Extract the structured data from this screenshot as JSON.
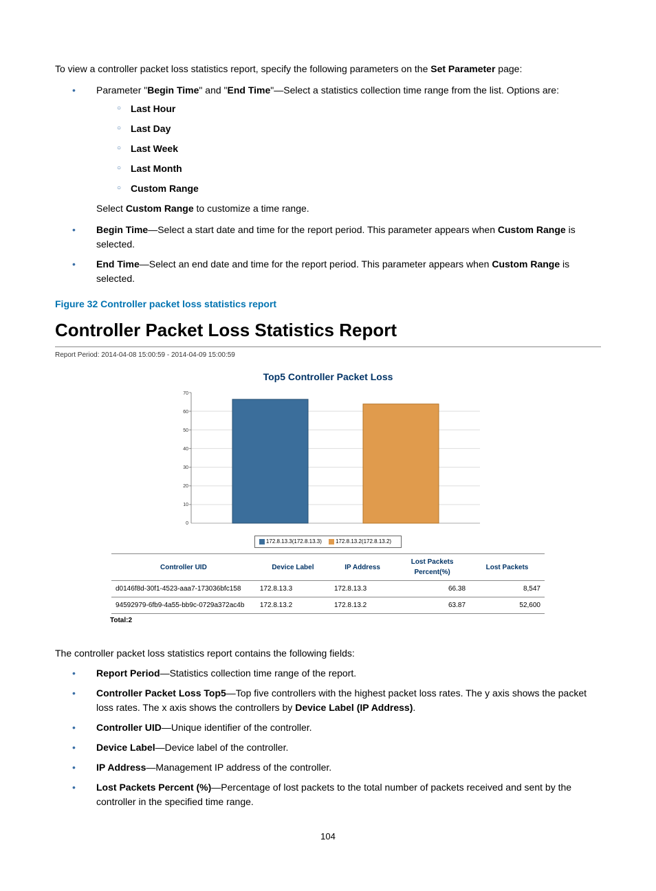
{
  "intro": {
    "prefix": "To view a controller packet loss statistics report, specify the following parameters on the ",
    "bold": "Set Parameter",
    "suffix": " page:"
  },
  "param_list": {
    "item1": {
      "prefix": "Parameter \"",
      "bold1": "Begin Time",
      "mid1": "\" and \"",
      "bold2": "End Time",
      "suffix": "\"—Select a statistics collection time range from the list. Options are:"
    },
    "options": [
      "Last Hour",
      "Last Day",
      "Last Week",
      "Last Month",
      "Custom Range"
    ],
    "sub_note": {
      "prefix": "Select ",
      "bold": "Custom Range",
      "suffix": " to customize a time range."
    },
    "item2": {
      "bold": "Begin Time",
      "text": "—Select a start date and time for the report period. This parameter appears when ",
      "bold2": "Custom Range",
      "suffix": " is selected."
    },
    "item3": {
      "bold": "End Time",
      "text": "—Select an end date and time for the report period. This parameter appears when ",
      "bold2": "Custom Range",
      "suffix": " is selected."
    }
  },
  "figure_caption": "Figure 32 Controller packet loss statistics report",
  "report": {
    "title": "Controller Packet Loss Statistics Report",
    "period": "Report Period: 2014-04-08 15:00:59  -  2014-04-09 15:00:59",
    "chart_title": "Top5 Controller Packet Loss",
    "legend": [
      {
        "color": "#3b6e9b",
        "label": "172.8.13.3(172.8.13.3)"
      },
      {
        "color": "#e09b4d",
        "label": "172.8.13.2(172.8.13.2)"
      }
    ],
    "table": {
      "headers": [
        "Controller UID",
        "Device Label",
        "IP Address",
        "Lost Packets\nPercent(%)",
        "Lost  Packets"
      ],
      "rows": [
        {
          "uid": "d0146f8d-30f1-4523-aaa7-173036bfc158",
          "label": "172.8.13.3",
          "ip": "172.8.13.3",
          "pct": "66.38",
          "lost": "8,547"
        },
        {
          "uid": "94592979-6fb9-4a55-bb9c-0729a372ac4b",
          "label": "172.8.13.2",
          "ip": "172.8.13.2",
          "pct": "63.87",
          "lost": "52,600"
        }
      ],
      "total": "Total:2"
    }
  },
  "chart_data": {
    "type": "bar",
    "title": "Top5 Controller Packet Loss",
    "xlabel": "",
    "ylabel": "",
    "ylim": [
      0,
      70
    ],
    "yticks": [
      0,
      10,
      20,
      30,
      40,
      50,
      60,
      70
    ],
    "series": [
      {
        "name": "172.8.13.3(172.8.13.3)",
        "color": "#3b6e9b",
        "values": [
          66.38
        ]
      },
      {
        "name": "172.8.13.2(172.8.13.2)",
        "color": "#e09b4d",
        "values": [
          63.87
        ]
      }
    ]
  },
  "post_intro": "The controller packet loss statistics report contains the following fields:",
  "fields": [
    {
      "bold": "Report Period",
      "text": "—Statistics collection time range of the report."
    },
    {
      "bold": "Controller Packet Loss Top5",
      "text": "—Top five controllers with the highest packet loss rates. The y axis shows the packet loss rates. The x axis shows the controllers by ",
      "bold2": "Device Label (IP Address)",
      "suffix": "."
    },
    {
      "bold": "Controller UID",
      "text": "—Unique identifier of the controller."
    },
    {
      "bold": "Device Label",
      "text": "—Device label of the controller."
    },
    {
      "bold": "IP Address",
      "text": "—Management IP address of the controller."
    },
    {
      "bold": "Lost Packets Percent (%)",
      "text": "—Percentage of lost packets to the total number of packets received and sent by the controller in the specified time range."
    }
  ],
  "page_number": "104"
}
